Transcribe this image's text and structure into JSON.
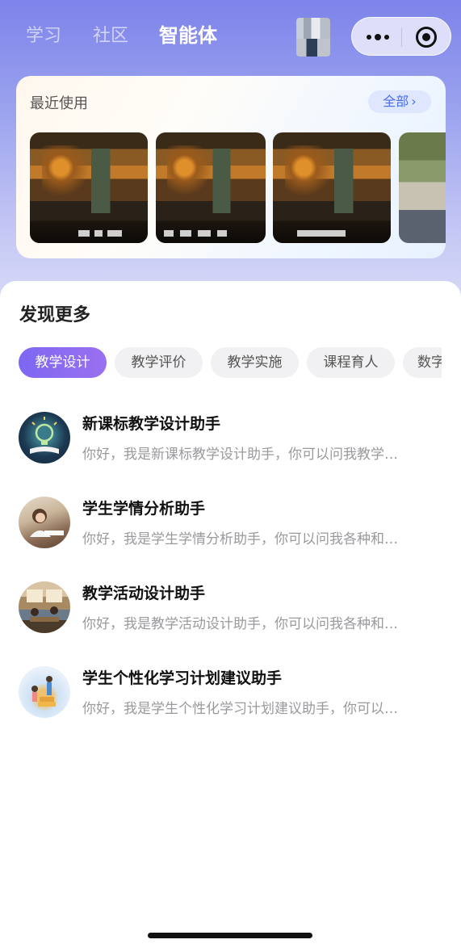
{
  "top_nav": {
    "tabs": [
      {
        "label": "学习",
        "active": false
      },
      {
        "label": "社区",
        "active": false
      },
      {
        "label": "智能体",
        "active": true
      }
    ]
  },
  "recent": {
    "title": "最近使用",
    "all_label": "全部",
    "items_count_visible": 4
  },
  "discover": {
    "title": "发现更多",
    "chips": [
      {
        "label": "教学设计",
        "active": true
      },
      {
        "label": "教学评价",
        "active": false
      },
      {
        "label": "教学实施",
        "active": false
      },
      {
        "label": "课程育人",
        "active": false
      },
      {
        "label": "数字",
        "active": false
      }
    ],
    "agents": [
      {
        "name": "新课标教学设计助手",
        "desc": "你好，我是新课标教学设计助手，你可以问我教学…"
      },
      {
        "name": "学生学情分析助手",
        "desc": "你好，我是学生学情分析助手，你可以问我各种和…"
      },
      {
        "name": "教学活动设计助手",
        "desc": "你好，我是教学活动设计助手，你可以问我各种和…"
      },
      {
        "name": "学生个性化学习计划建议助手",
        "desc": "你好，我是学生个性化学习计划建议助手，你可以…"
      }
    ]
  },
  "colors": {
    "accent": "#7e67f2",
    "link": "#4a6cf0"
  }
}
